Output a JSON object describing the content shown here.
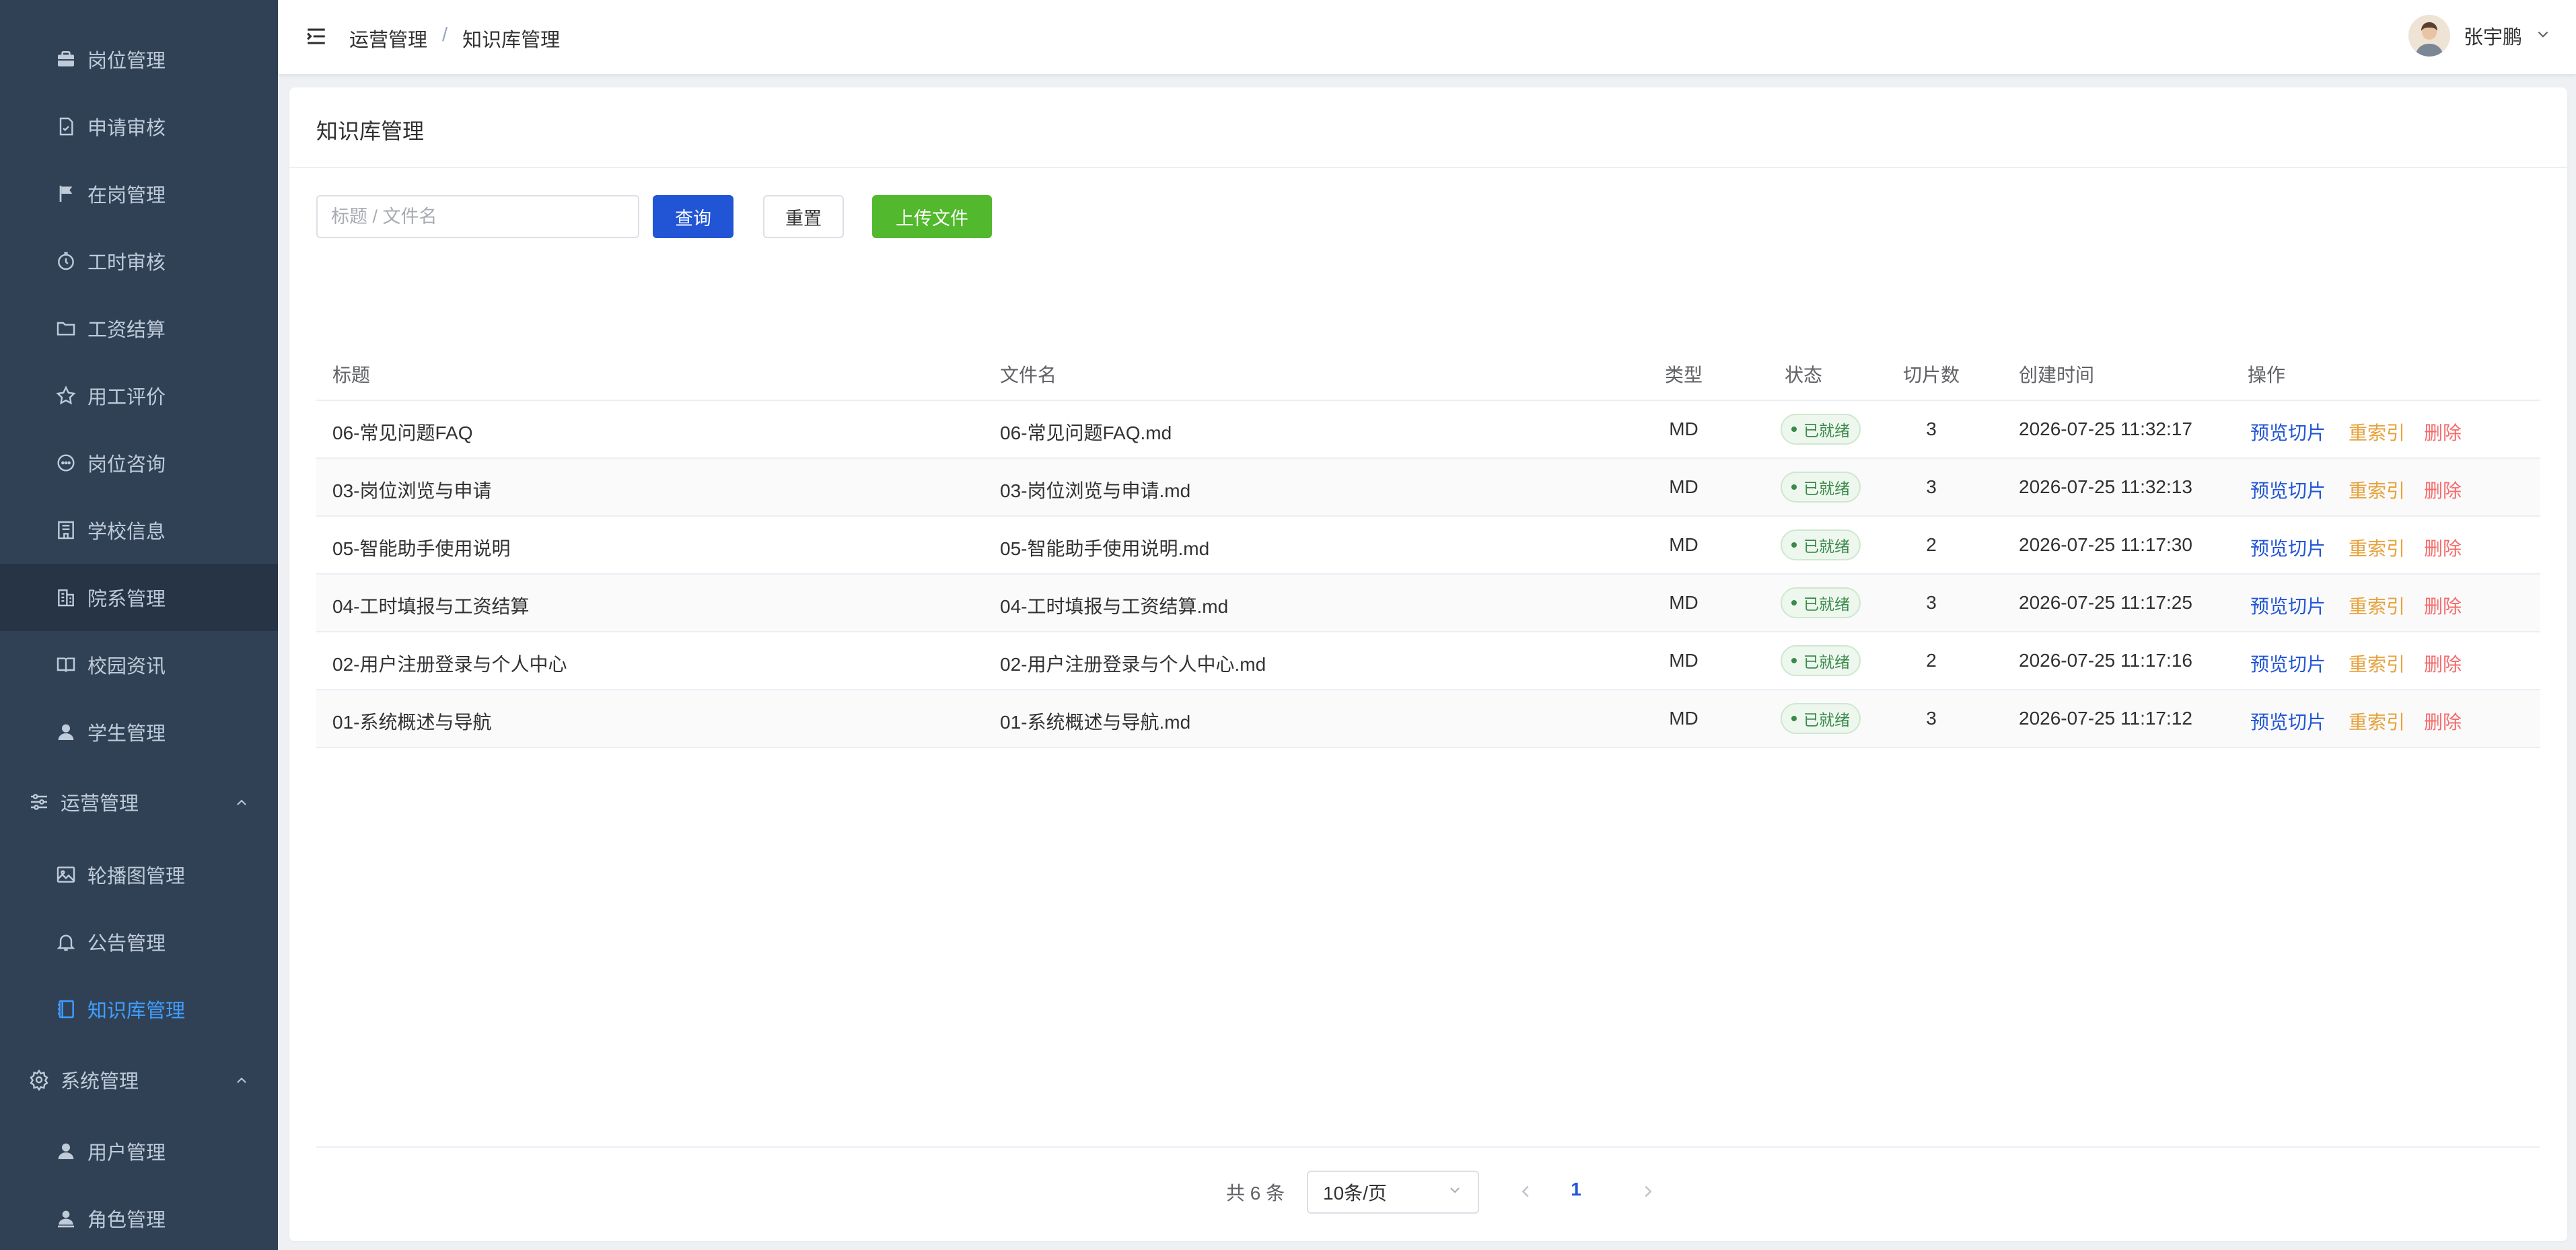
{
  "sidebar": {
    "items": [
      {
        "label": "岗位管理",
        "icon": "briefcase-icon"
      },
      {
        "label": "申请审核",
        "icon": "document-check-icon"
      },
      {
        "label": "在岗管理",
        "icon": "flag-icon"
      },
      {
        "label": "工时审核",
        "icon": "stopwatch-icon"
      },
      {
        "label": "工资结算",
        "icon": "folder-icon"
      },
      {
        "label": "用工评价",
        "icon": "star-icon"
      },
      {
        "label": "岗位咨询",
        "icon": "chat-icon"
      },
      {
        "label": "学校信息",
        "icon": "school-icon"
      },
      {
        "label": "院系管理",
        "icon": "building-icon"
      },
      {
        "label": "校园资讯",
        "icon": "book-icon"
      },
      {
        "label": "学生管理",
        "icon": "user-icon"
      }
    ],
    "groups": [
      {
        "label": "运营管理",
        "icon": "sliders-icon"
      },
      {
        "label": "系统管理",
        "icon": "gear-icon"
      }
    ],
    "ops_items": [
      {
        "label": "轮播图管理",
        "icon": "image-icon"
      },
      {
        "label": "公告管理",
        "icon": "bell-icon"
      },
      {
        "label": "知识库管理",
        "icon": "notebook-icon"
      }
    ],
    "sys_items": [
      {
        "label": "用户管理",
        "icon": "user-icon"
      },
      {
        "label": "角色管理",
        "icon": "user-role-icon"
      }
    ]
  },
  "header": {
    "breadcrumb": [
      "运营管理",
      "知识库管理"
    ],
    "user_name": "张宇鹏"
  },
  "page": {
    "title": "知识库管理",
    "search_placeholder": "标题 / 文件名",
    "query_label": "查询",
    "reset_label": "重置",
    "upload_label": "上传文件"
  },
  "table": {
    "columns": [
      "标题",
      "文件名",
      "类型",
      "状态",
      "切片数",
      "创建时间",
      "操作"
    ],
    "rows": [
      {
        "title": "06-常见问题FAQ",
        "file": "06-常见问题FAQ.md",
        "type": "MD",
        "status": "已就绪",
        "chunks": "3",
        "created": "2026-07-25 11:32:17"
      },
      {
        "title": "03-岗位浏览与申请",
        "file": "03-岗位浏览与申请.md",
        "type": "MD",
        "status": "已就绪",
        "chunks": "3",
        "created": "2026-07-25 11:32:13"
      },
      {
        "title": "05-智能助手使用说明",
        "file": "05-智能助手使用说明.md",
        "type": "MD",
        "status": "已就绪",
        "chunks": "2",
        "created": "2026-07-25 11:17:30"
      },
      {
        "title": "04-工时填报与工资结算",
        "file": "04-工时填报与工资结算.md",
        "type": "MD",
        "status": "已就绪",
        "chunks": "3",
        "created": "2026-07-25 11:17:25"
      },
      {
        "title": "02-用户注册登录与个人中心",
        "file": "02-用户注册登录与个人中心.md",
        "type": "MD",
        "status": "已就绪",
        "chunks": "2",
        "created": "2026-07-25 11:17:16"
      },
      {
        "title": "01-系统概述与导航",
        "file": "01-系统概述与导航.md",
        "type": "MD",
        "status": "已就绪",
        "chunks": "3",
        "created": "2026-07-25 11:17:12"
      }
    ],
    "actions": {
      "preview": "预览切片",
      "reindex": "重索引",
      "delete": "删除"
    }
  },
  "pagination": {
    "total_text": "共 6 条",
    "page_size": "10条/页",
    "current_page": "1"
  },
  "colors": {
    "sidebar_bg": "#304156",
    "active": "#409eff",
    "primary": "#2155d6",
    "success": "#52b82d",
    "warning": "#e6a23c",
    "danger": "#f56c6c"
  }
}
